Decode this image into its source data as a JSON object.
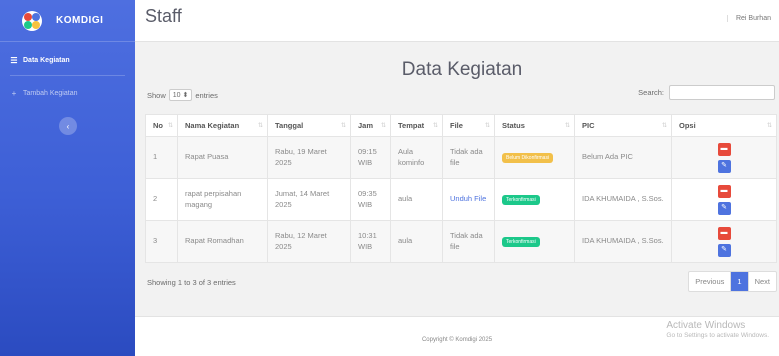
{
  "sidebar": {
    "brand": "KOMDIGI",
    "items": [
      {
        "label": "Data Kegiatan",
        "icon": "list-icon"
      },
      {
        "label": "Tambah Kegiatan",
        "icon": "plus-icon"
      }
    ],
    "toggle_icon": "chevron-left-icon"
  },
  "header": {
    "title": "Staff",
    "user": "Rei Burhan"
  },
  "main": {
    "heading": "Data Kegiatan",
    "show_label": "Show",
    "show_value": "10",
    "entries_label": "entries",
    "search_label": "Search:",
    "search_value": "",
    "columns": [
      "No",
      "Nama Kegiatan",
      "Tanggal",
      "Jam",
      "Tempat",
      "File",
      "Status",
      "PIC",
      "Opsi"
    ],
    "rows": [
      {
        "no": "1",
        "nama": "Rapat Puasa",
        "tanggal": "Rabu, 19 Maret 2025",
        "jam": "09:15 WIB",
        "tempat": "Aula kominfo",
        "file": "Tidak ada file",
        "status": "Belum Dikonfirmasi",
        "pic": "Belum Ada PIC"
      },
      {
        "no": "2",
        "nama": "rapat perpisahan magang",
        "tanggal": "Jumat, 14 Maret 2025",
        "jam": "09:35 WIB",
        "tempat": "aula",
        "file": "Unduh File",
        "status": "Terkonfirmasi",
        "pic": "IDA KHUMAIDA , S.Sos."
      },
      {
        "no": "3",
        "nama": "Rapat Romadhan",
        "tanggal": "Rabu, 12 Maret 2025",
        "jam": "10:31 WIB",
        "tempat": "aula",
        "file": "Tidak ada file",
        "status": "Terkonfirmasi",
        "pic": "IDA KHUMAIDA , S.Sos."
      }
    ],
    "info": "Showing 1 to 3 of 3 entries",
    "pagination": {
      "previous": "Previous",
      "current": "1",
      "next": "Next"
    }
  },
  "footer": {
    "copyright": "Copyright © Komdigi 2025",
    "activate_title": "Activate Windows",
    "activate_sub": "Go to Settings to activate Windows."
  },
  "colors": {
    "sidebar": "#4e73df",
    "danger": "#e74a3b",
    "success": "#1cc88a",
    "warning": "#f6c23e"
  }
}
